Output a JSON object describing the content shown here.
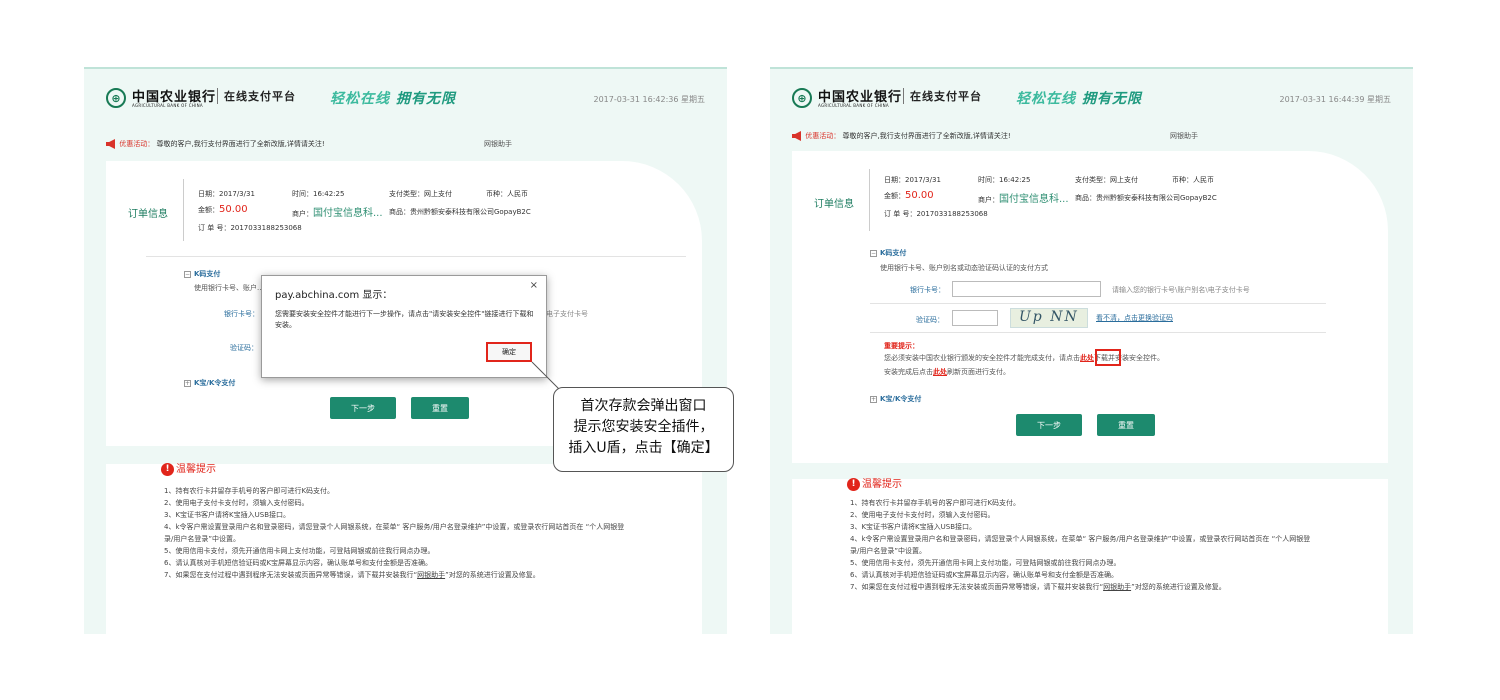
{
  "left": {
    "header": {
      "bank_name": "中国农业银行",
      "bank_en": "AGRICULTURAL BANK OF CHINA",
      "platform": "在线支付平台",
      "slogan_1": "轻松在线",
      "slogan_2": "拥有无限",
      "datetime": "2017-03-31 16:42:36 星期五"
    },
    "notice": {
      "label": "优惠活动：",
      "text": "尊敬的客户,我行支付界面进行了全新改版,详情请关注!",
      "helper": "网银助手"
    },
    "order": {
      "title": "订单信息",
      "date": "日期：2017/3/31",
      "time": "时间：16:42:25",
      "pay_type": "支付类型：网上支付",
      "currency": "币种：人民币",
      "amount_label": "金额：",
      "amount": "50.00",
      "merchant_label": "商户：",
      "merchant": "国付宝信息科...",
      "goods": "商品：贵州黔额安泰科技有限公司GopayB2C",
      "order_no": "订 单 号：2017033188253068"
    },
    "pay": {
      "kcode_title": "K码支付",
      "kcode_desc": "使用银行卡号、账户...",
      "card_label": "银行卡号：",
      "card_hint_tail": "电子支付卡号",
      "captcha_label": "验证码：",
      "kbao_title": "K宝/K令支付",
      "next_btn": "下一步",
      "reset_btn": "重置"
    },
    "dialog": {
      "title": "pay.abchina.com 显示：",
      "close": "×",
      "message": "您需要安装安全控件才能进行下一步操作，请点击\"请安装安全控件\"链接进行下载和安装。",
      "ok": "确定"
    },
    "tips": {
      "title": "温馨提示",
      "items": [
        "1、持有农行卡并留存手机号的客户即可进行K码支付。",
        "2、使用电子支付卡支付时，须输入支付密码。",
        "3、K宝证书客户请将K宝插入USB接口。",
        "4、k令客户需设置登录用户名和登录密码，请您登录个人网银系统，在菜单“ 客户服务/用户名登录维护”中设置，或登录农行网站首页在 “个人网银登",
        "录/用户名登录”中设置。",
        "5、使用信用卡支付，须先开通信用卡网上支付功能，可登陆网银或前往我行网点办理。",
        "6、请认真核对手机短信验证码或K宝屏幕显示内容，确认账单号和支付金额是否准确。"
      ],
      "item7_pre": "7、如果您在支付过程中遇到程序无法安装或页面异常等错误，请下载并安装我行“",
      "item7_link": "网银助手",
      "item7_post": "”对您的系统进行设置及修复。"
    }
  },
  "right": {
    "header": {
      "bank_name": "中国农业银行",
      "bank_en": "AGRICULTURAL BANK OF CHINA",
      "platform": "在线支付平台",
      "slogan_1": "轻松在线",
      "slogan_2": "拥有无限",
      "datetime": "2017-03-31 16:44:39 星期五"
    },
    "notice": {
      "label": "优惠活动：",
      "text": "尊敬的客户,我行支付界面进行了全新改版,详情请关注!",
      "helper": "网银助手"
    },
    "order": {
      "title": "订单信息",
      "date": "日期：2017/3/31",
      "time": "时间：16:42:25",
      "pay_type": "支付类型：网上支付",
      "currency": "币种：人民币",
      "amount_label": "金额：",
      "amount": "50.00",
      "merchant_label": "商户：",
      "merchant": "国付宝信息科...",
      "goods": "商品：贵州黔额安泰科技有限公司GopayB2C",
      "order_no": "订 单 号：2017033188253068"
    },
    "pay": {
      "kcode_title": "K码支付",
      "kcode_desc": "使用银行卡号、账户别名或动态验证码认证的支付方式",
      "card_label": "银行卡号：",
      "card_hint": "请输入您的银行卡号\\账户别名\\电子支付卡号",
      "captcha_label": "验证码：",
      "captcha_text": "Up NN",
      "captcha_refresh": "看不清，点击更换验证码",
      "important_title": "重要提示：",
      "important_1a": "您必须安装中国农业银行颁发的安全控件才能完成支付，请点击",
      "important_link": "此处",
      "important_1b": "下载并安装安全控件。",
      "important_2a": "安装完成后点击",
      "important_2b": "刷新页面进行支付。",
      "kbao_title": "K宝/K令支付",
      "next_btn": "下一步",
      "reset_btn": "重置"
    },
    "tips": {
      "title": "温馨提示",
      "items": [
        "1、持有农行卡并留存手机号的客户即可进行K码支付。",
        "2、使用电子支付卡支付时，须输入支付密码。",
        "3、K宝证书客户请将K宝插入USB接口。",
        "4、k令客户需设置登录用户名和登录密码，请您登录个人网银系统，在菜单“ 客户服务/用户名登录维护”中设置，或登录农行网站首页在 “个人网银登",
        "录/用户名登录”中设置。",
        "5、使用信用卡支付，须先开通信用卡网上支付功能，可登陆网银或前往我行网点办理。",
        "6、请认真核对手机短信验证码或K宝屏幕显示内容，确认账单号和支付金额是否准确。"
      ],
      "item7_pre": "7、如果您在支付过程中遇到程序无法安装或页面异常等错误，请下载并安装我行“",
      "item7_link": "网银助手",
      "item7_post": "”对您的系统进行设置及修复。"
    }
  },
  "callout": {
    "line1": "首次存款会弹出窗口",
    "line2": "提示您安装安全插件，",
    "line3": "插入U盾，点击【确定】"
  }
}
